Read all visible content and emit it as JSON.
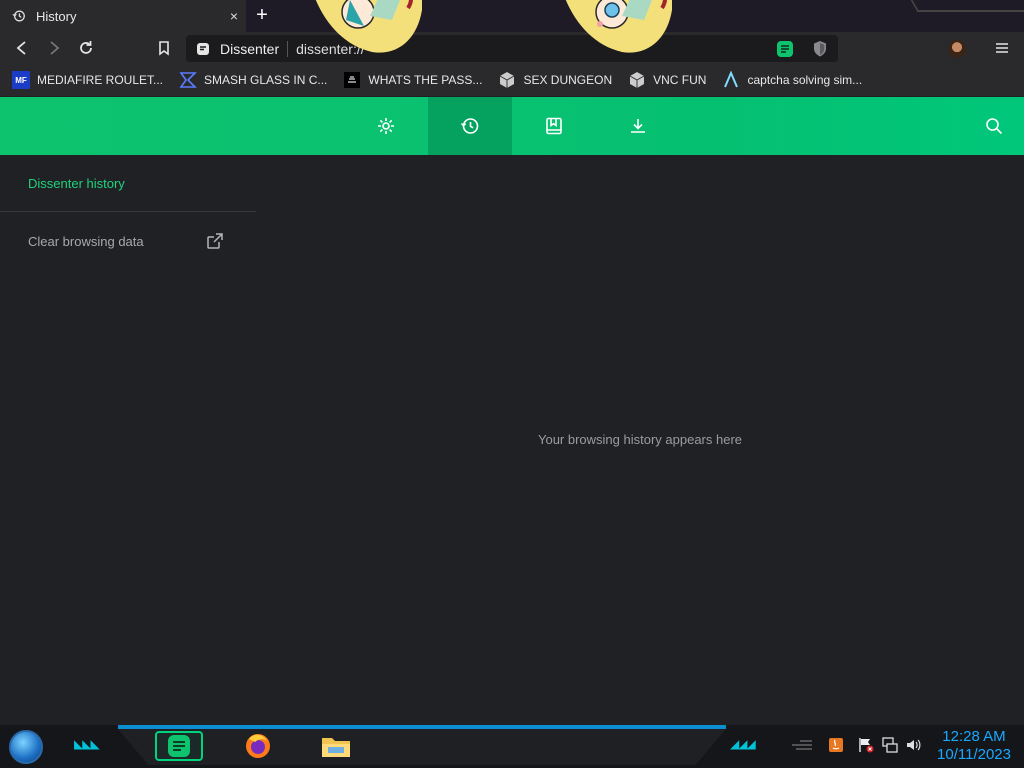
{
  "tab": {
    "title": "History",
    "close": "×",
    "new_tab": "+"
  },
  "omnibox": {
    "site_name": "Dissenter",
    "url": "dissenter://"
  },
  "bookmarks": [
    {
      "label": "MEDIAFIRE ROULET...",
      "icon": "MF"
    },
    {
      "label": "SMASH GLASS IN C...",
      "icon": "smash-icon"
    },
    {
      "label": "WHATS THE PASS...",
      "icon": "pass-icon"
    },
    {
      "label": "SEX DUNGEON",
      "icon": "cube-icon"
    },
    {
      "label": "VNC FUN",
      "icon": "cube-icon"
    },
    {
      "label": "captcha solving sim...",
      "icon": "lambda-icon"
    }
  ],
  "sidebar": {
    "title": "Dissenter history",
    "items": [
      {
        "label": "Clear browsing data"
      }
    ]
  },
  "main": {
    "empty_message": "Your browsing history appears here"
  },
  "taskbar": {
    "time": "12:28 AM",
    "date": "10/11/2023"
  },
  "colors": {
    "accent": "#00c16e",
    "accent_dark": "#05a25f",
    "background": "#202124",
    "clock": "#18a9ff"
  }
}
